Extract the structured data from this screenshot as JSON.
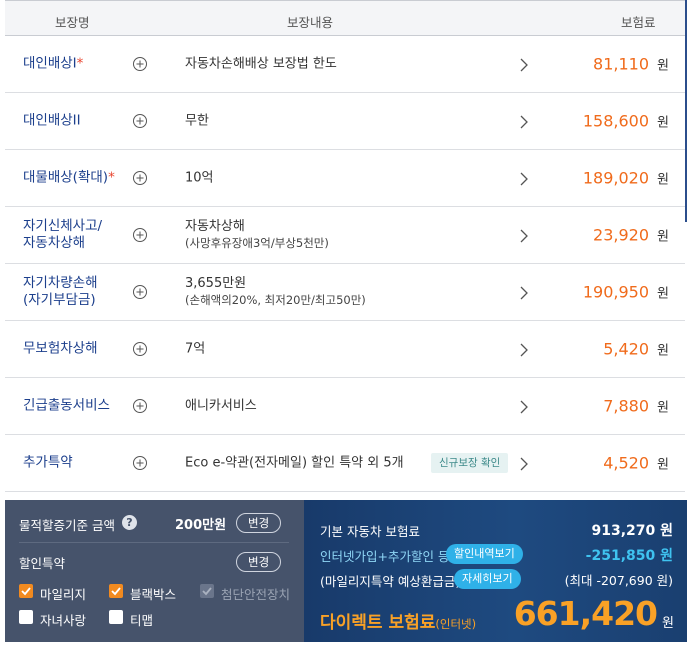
{
  "header": {
    "name": "보장명",
    "content": "보장내용",
    "premium": "보험료"
  },
  "rows": [
    {
      "name": "대인배상I",
      "star": "*",
      "content": "자동차손해배상 보장법 한도",
      "sub": "",
      "tag": "",
      "price": "81,110",
      "unit": "원"
    },
    {
      "name": "대인배상II",
      "star": "",
      "content": "무한",
      "sub": "",
      "tag": "",
      "price": "158,600",
      "unit": "원"
    },
    {
      "name": "대물배상(확대)",
      "star": "*",
      "content": "10억",
      "sub": "",
      "tag": "",
      "price": "189,020",
      "unit": "원"
    },
    {
      "name": "자기신체사고/\n자동차상해",
      "star": "",
      "content": "자동차상해",
      "sub": "(사망후유장애3억/부상5천만)",
      "tag": "",
      "price": "23,920",
      "unit": "원"
    },
    {
      "name": "자기차량손해\n(자기부담금)",
      "star": "",
      "content": "3,655만원",
      "sub": "(손해액의20%, 최저20만/최고50만)",
      "tag": "",
      "price": "190,950",
      "unit": "원"
    },
    {
      "name": "무보험차상해",
      "star": "",
      "content": "7억",
      "sub": "",
      "tag": "",
      "price": "5,420",
      "unit": "원"
    },
    {
      "name": "긴급출동서비스",
      "star": "",
      "content": "애니카서비스",
      "sub": "",
      "tag": "",
      "price": "7,880",
      "unit": "원"
    },
    {
      "name": "추가특약",
      "star": "",
      "content": "Eco e-약관(전자메일) 할인 특약 외 5개",
      "sub": "",
      "tag": "신규보장 확인",
      "price": "4,520",
      "unit": "원"
    }
  ],
  "left_panel": {
    "property_label": "물적할증기준 금액",
    "help_icon": "?",
    "property_amount": "200만원",
    "change_button": "변경",
    "discount_label": "할인특약",
    "discount_change_button": "변경",
    "checkboxes": [
      {
        "label": "마일리지",
        "state": "checked"
      },
      {
        "label": "블랙박스",
        "state": "checked"
      },
      {
        "label": "첨단안전장치",
        "state": "disabled"
      },
      {
        "label": "자녀사랑",
        "state": "unchecked"
      },
      {
        "label": "티맵",
        "state": "unchecked"
      }
    ]
  },
  "right_panel": {
    "base_label": "기본 자동차 보험료",
    "base_value": "913,270 원",
    "discount_label": "인터넷가입+추가할인 등",
    "discount_button": "할인내역보기",
    "discount_value": "-251,850 원",
    "mileage_label": "(마일리지특약 예상환급금)",
    "mileage_button": "자세히보기",
    "mileage_value": "(최대 -207,690 원)",
    "final_label": "다이렉트 보험료",
    "final_label_suffix": "(인터넷)",
    "final_value": "661,420",
    "final_unit": "원"
  },
  "colors": {
    "accent_orange": "#f06b1c",
    "navy": "#1c3f8c",
    "checkbox_orange": "#f28a1f",
    "cyan": "#3fc3f0",
    "final_orange": "#f9a126"
  }
}
